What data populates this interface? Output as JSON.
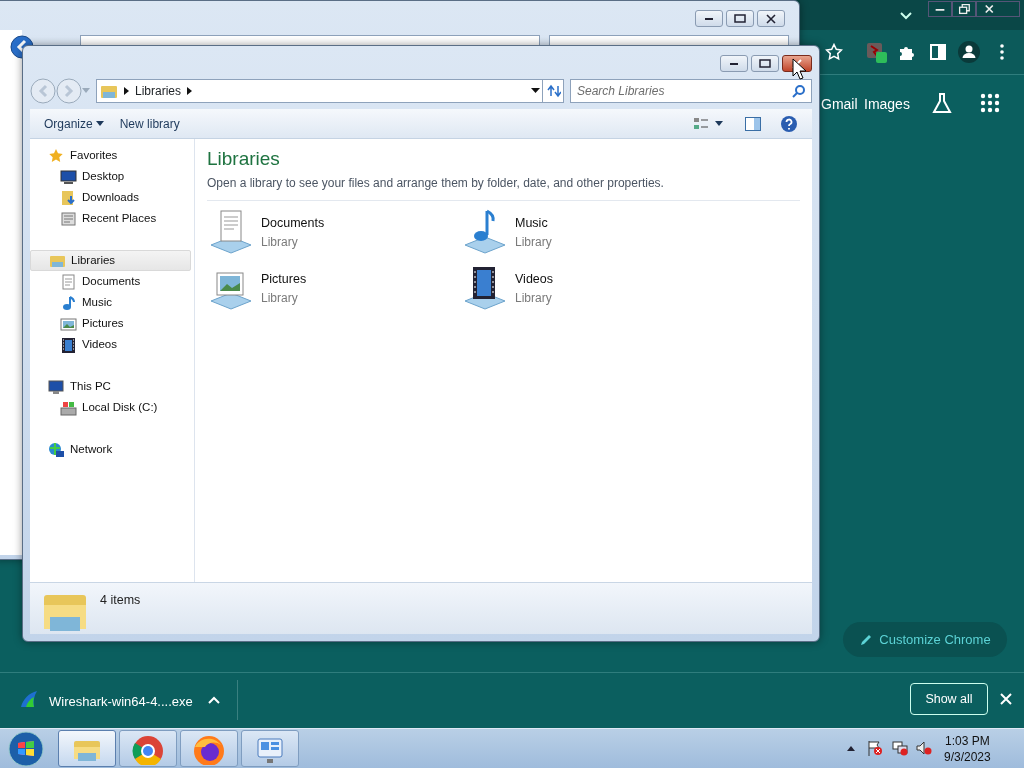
{
  "chrome": {
    "top_links": [
      "Gmail",
      "Images"
    ],
    "customize_button": "Customize Chrome",
    "download": {
      "file": "Wireshark-win64-4....exe"
    },
    "show_all": "Show all"
  },
  "explorer": {
    "address": [
      "Libraries"
    ],
    "search": {
      "placeholder": "Search Libraries"
    },
    "commands": [
      {
        "label": "Organize",
        "kind": "menu"
      },
      {
        "label": "New library",
        "kind": "plain"
      }
    ],
    "nav": [
      {
        "label": "Favorites",
        "kind": "star",
        "selected": false,
        "children": [
          {
            "label": "Desktop",
            "kind": "desktop",
            "selected": false
          },
          {
            "label": "Downloads",
            "kind": "downloads",
            "selected": false
          },
          {
            "label": "Recent Places",
            "kind": "recent",
            "selected": false
          }
        ]
      },
      {
        "label": "Libraries",
        "kind": "library",
        "selected": true,
        "children": [
          {
            "label": "Documents",
            "kind": "documents",
            "selected": false
          },
          {
            "label": "Music",
            "kind": "music",
            "selected": false
          },
          {
            "label": "Pictures",
            "kind": "pictures",
            "selected": false
          },
          {
            "label": "Videos",
            "kind": "videos",
            "selected": false
          }
        ]
      },
      {
        "label": "This PC",
        "kind": "pc",
        "selected": false,
        "children": [
          {
            "label": "Local Disk (C:)",
            "kind": "disk",
            "selected": false
          }
        ]
      },
      {
        "label": "Network",
        "kind": "network",
        "selected": false
      }
    ],
    "heading": "Libraries",
    "description": "Open a library to see your files and arrange them by folder, date, and other properties.",
    "libraries": [
      {
        "name": "Documents",
        "type": "Library",
        "kind": "documents"
      },
      {
        "name": "Music",
        "type": "Library",
        "kind": "music"
      },
      {
        "name": "Pictures",
        "type": "Library",
        "kind": "pictures"
      },
      {
        "name": "Videos",
        "type": "Library",
        "kind": "videos"
      }
    ],
    "status": "4 items"
  },
  "taskbar": {
    "apps": [
      {
        "kind": "explorer",
        "selected": true
      },
      {
        "kind": "chrome",
        "selected": false
      },
      {
        "kind": "firefox",
        "selected": false
      },
      {
        "kind": "control",
        "selected": false
      }
    ],
    "time": "1:03 PM",
    "date": "9/3/2023"
  }
}
